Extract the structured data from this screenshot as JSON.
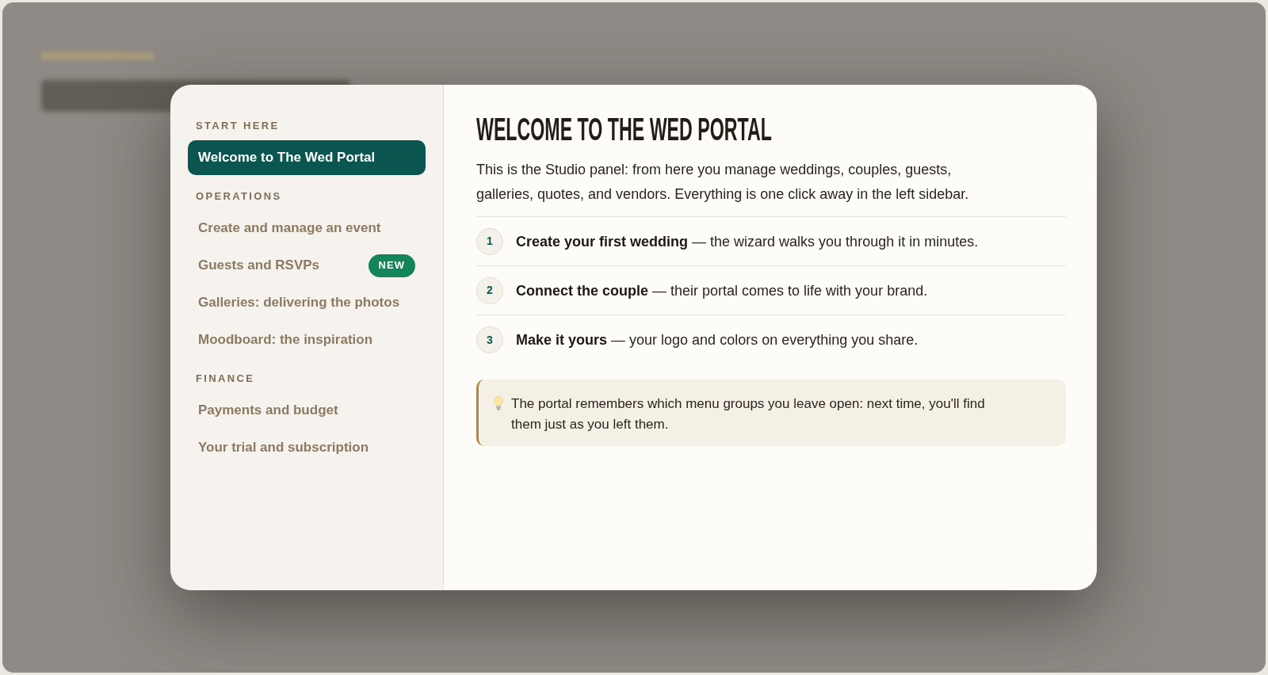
{
  "sidebar": {
    "groups": [
      {
        "label": "START HERE",
        "items": [
          {
            "label": "Welcome to The Wed Portal",
            "selected": true
          }
        ]
      },
      {
        "label": "OPERATIONS",
        "items": [
          {
            "label": "Create and manage an event",
            "selected": false
          },
          {
            "label": "Guests and RSVPs",
            "selected": false,
            "badge": "NEW"
          },
          {
            "label": "Galleries: delivering the photos",
            "selected": false
          },
          {
            "label": "Moodboard: the inspiration",
            "selected": false
          }
        ]
      },
      {
        "label": "FINANCE",
        "items": [
          {
            "label": "Payments and budget",
            "selected": false
          },
          {
            "label": "Your trial and subscription",
            "selected": false
          }
        ]
      }
    ]
  },
  "content": {
    "title": "WELCOME TO THE WED PORTAL",
    "intro": "This is the Studio panel: from here you manage weddings, couples, guests, galleries, quotes, and vendors. Everything is one click away in the left sidebar.",
    "steps": [
      {
        "number": "1",
        "text": "**Create your first wedding** — the wizard walks you through it in minutes."
      },
      {
        "number": "2",
        "text": "**Connect the couple** — their portal comes to life with your brand."
      },
      {
        "number": "3",
        "text": "**Make it yours** — your logo and colors on everything you share."
      }
    ],
    "tip": {
      "text": "The portal remembers which menu groups you leave open: next time, you'll find them just as you left them."
    }
  }
}
